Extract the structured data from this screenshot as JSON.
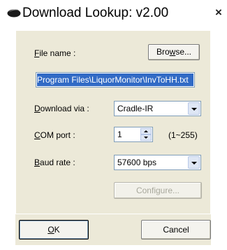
{
  "window": {
    "title": "Download Lookup: v2.00",
    "close_glyph": "×",
    "logo_icon": "app-logo-icon"
  },
  "form": {
    "file_name_label_first": "F",
    "file_name_label_rest": "ile name :",
    "browse_label_pre": "Bro",
    "browse_label_accel": "w",
    "browse_label_post": "se...",
    "file_path_value": "Program Files\\LiquorMonitor\\InvToHH.txt",
    "download_via_label_first": "D",
    "download_via_label_rest": "ownload via :",
    "download_via_value": "Cradle-IR",
    "com_port_label_first": "C",
    "com_port_label_rest": "OM port :",
    "com_port_value": "1",
    "com_port_range": "(1~255)",
    "baud_rate_label_first": "B",
    "baud_rate_label_rest": "aud rate :",
    "baud_rate_value": "57600 bps",
    "configure_label": "Configure..."
  },
  "footer": {
    "ok_label_first": "O",
    "ok_label_rest": "K",
    "cancel_label": "Cancel"
  },
  "colors": {
    "dialog_bg": "#ece9d8",
    "selection_bg": "#316ac5",
    "field_border": "#7f9db9"
  }
}
